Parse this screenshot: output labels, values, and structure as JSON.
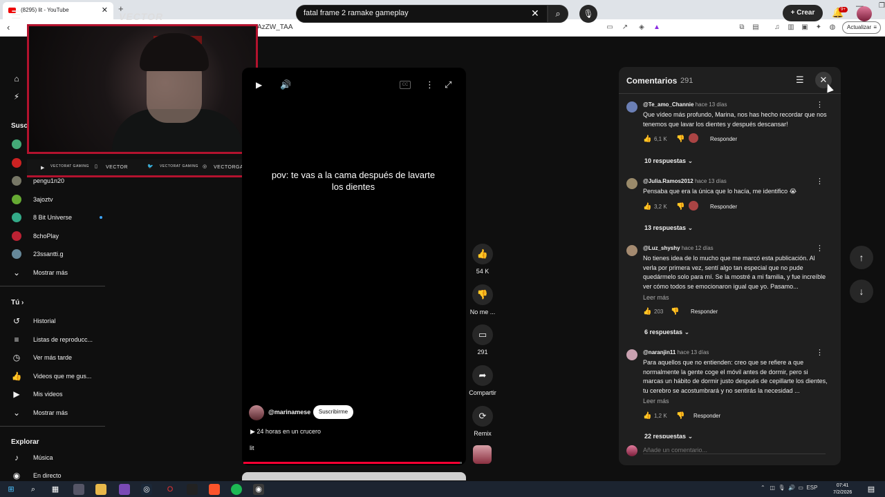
{
  "browser": {
    "tab_title": "(8295) lit - YouTube",
    "tab_close": "✕",
    "new_tab": "+",
    "url_fragment": "AzZW_TAA",
    "update_label": "Actualizar",
    "win_min": "—",
    "win_max": "❐",
    "win_close": "✕"
  },
  "header": {
    "search_value": "fatal frame 2 ramake gameplay",
    "create_label": "Crear",
    "notif_badge": "9+"
  },
  "overlay": {
    "logo_text": "VECTOR",
    "social": [
      "VECTORAT GAMING",
      "VECTOR",
      "VECTORAT GAMING",
      "VECTORGA"
    ]
  },
  "sidebar": {
    "subs_heading": "Susc",
    "subs": [
      "pengu1n20",
      "3ajoztv",
      "8 Bit Universe",
      "8choPlay",
      "23ssantti.g"
    ],
    "show_more": "Mostrar más",
    "you_heading": "Tú",
    "you_items": [
      "Historial",
      "Listas de reproducc...",
      "Ver más tarde",
      "Videos que me gus...",
      "Mis videos"
    ],
    "show_more_2": "Mostrar más",
    "explore_heading": "Explorar",
    "explore_items": [
      "Música",
      "En directo"
    ]
  },
  "video": {
    "caption": "pov: te vas a la cama después de lavarte los dientes",
    "channel": "@marinamese",
    "subscribe": "Suscribirme",
    "playlist": "24 horas en un crucero",
    "title": "lit",
    "progress_fraction": 0.99
  },
  "actions": {
    "likes": "54 K",
    "dislike": "No me ...",
    "comments": "291",
    "share": "Compartir",
    "remix": "Remix"
  },
  "comments_panel": {
    "title": "Comentarios",
    "count": "291",
    "add_placeholder": "Añade un comentario...",
    "reply_label": "Responder",
    "read_more": "Leer más",
    "items": [
      {
        "author": "@Te_amo_Channie",
        "time": "hace 13 días",
        "text": "Que vídeo más profundo, Marina, nos has hecho recordar que nos tenemos que lavar los dientes y después descansar!",
        "likes": "6,1 K",
        "replies": "10 respuestas"
      },
      {
        "author": "@Julia.Ramos2012",
        "time": "hace 13 días",
        "text": "Pensaba que era la única que lo hacía, me identifico 😭",
        "likes": "3,2 K",
        "replies": "13 respuestas"
      },
      {
        "author": "@Luz_shyshy",
        "time": "hace 12 días",
        "text": "No tienes idea de lo mucho que me marcó esta publicación. Al verla por primera vez, sentí algo tan especial que no pude quedármelo solo para mí. Se la mostré a mi familia, y fue increíble ver cómo todos se emocionaron igual que yo. Pasamo...",
        "likes": "203",
        "replies": "6 respuestas"
      },
      {
        "author": "@naranjin11",
        "time": "hace 13 días",
        "text": "Para aquellos que no entienden: creo que se refiere a que normalmente la gente coge el móvil antes de dormir, pero si marcas un hábito de dormir justo después de cepillarte los dientes, tu cerebro se acostumbrará y no sentirás la necesidad ...",
        "likes": "1,2 K",
        "replies": "22 respuestas"
      }
    ]
  },
  "taskbar": {
    "lang": "ESP",
    "time": "07:41",
    "date": "7/2/2026"
  },
  "colors": {
    "accent_red": "#b3122e",
    "yt_bg": "#0f0f0f",
    "panel_bg": "#1f1f1f"
  }
}
